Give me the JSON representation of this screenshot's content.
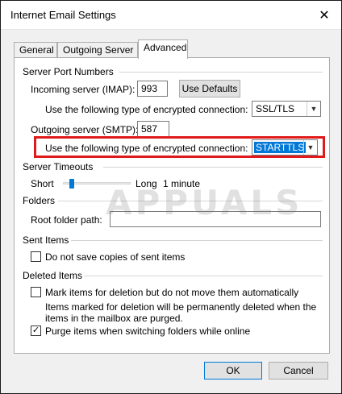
{
  "window": {
    "title": "Internet Email Settings",
    "close_glyph": "✕"
  },
  "tabs": [
    {
      "label": "General"
    },
    {
      "label": "Outgoing Server"
    },
    {
      "label": "Advanced",
      "active": true
    }
  ],
  "server_ports": {
    "group_title": "Server Port Numbers",
    "incoming_label": "Incoming server (IMAP):",
    "incoming_value": "993",
    "use_defaults": "Use Defaults",
    "enc_label_incoming": "Use the following type of encrypted connection:",
    "enc_incoming_value": "SSL/TLS",
    "outgoing_label": "Outgoing server (SMTP):",
    "outgoing_value": "587",
    "enc_label_outgoing": "Use the following type of encrypted connection:",
    "enc_outgoing_value": "STARTTLS"
  },
  "timeouts": {
    "group_title": "Server Timeouts",
    "short_label": "Short",
    "long_label": "Long",
    "value": "1 minute",
    "level": 0.1
  },
  "folders": {
    "group_title": "Folders",
    "root_label": "Root folder path:",
    "root_value": ""
  },
  "sent": {
    "group_title": "Sent Items",
    "no_copies_label": "Do not save copies of sent items",
    "no_copies_checked": false
  },
  "deleted": {
    "group_title": "Deleted Items",
    "mark_label": "Mark items for deletion but do not move them automatically",
    "mark_checked": false,
    "note": "Items marked for deletion will be permanently deleted when the items in the mailbox are purged.",
    "purge_label": "Purge items when switching folders while online",
    "purge_checked": true
  },
  "buttons": {
    "ok": "OK",
    "cancel": "Cancel"
  },
  "watermark": "APPUALS",
  "colors": {
    "highlight": "#e01a1a",
    "accent": "#0078d7"
  },
  "icons": {
    "dropdown": "chevron-down-icon",
    "check": "checkmark-icon",
    "close": "close-icon"
  }
}
